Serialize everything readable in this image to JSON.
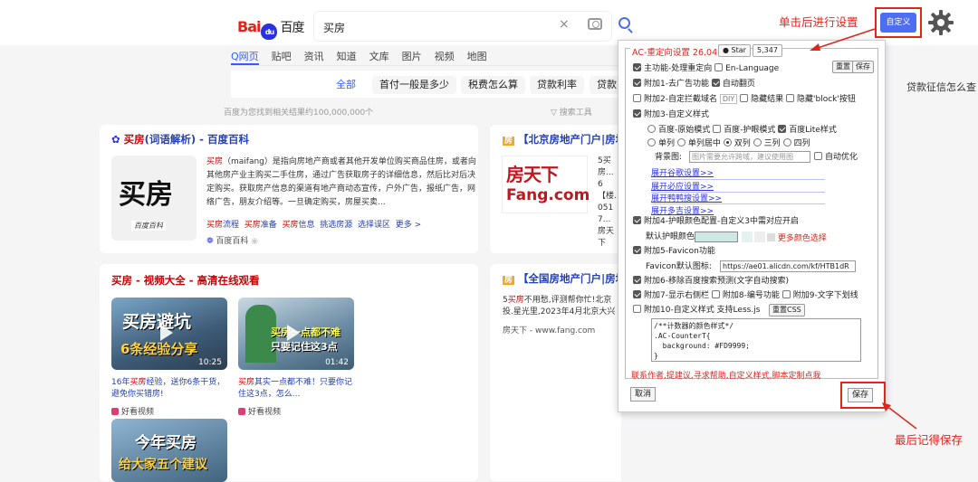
{
  "header": {
    "logo_bai": "Bai",
    "logo_du": "du",
    "logo_cn": "百度",
    "query": "买房",
    "clear_glyph": "×"
  },
  "tabs": [
    {
      "label": "Q网页",
      "active": true
    },
    {
      "label": "贴吧"
    },
    {
      "label": "资讯"
    },
    {
      "label": "知道"
    },
    {
      "label": "文库"
    },
    {
      "label": "图片"
    },
    {
      "label": "视频"
    },
    {
      "label": "地图"
    }
  ],
  "related_chips": [
    "全部",
    "首付一般是多少",
    "税费怎么算",
    "贷款利率",
    "贷款"
  ],
  "right_chip": "贷款征信怎么查",
  "result_count": "百度为您找到相关结果约100,000,000个",
  "search_tools": "搜索工具",
  "baike": {
    "title_kw": "买房",
    "title_rest": "(词语解析) - 百度百科",
    "img_big": "买房",
    "img_small": "百度百科",
    "text_kw": "买房",
    "text": "（maifang）是指向房地产商或者其他开发单位购买商品住房，或者向其他房产业主购买二手住房，通过广告获取房子的详细信息，然后比对后决定购买。获取房产信息的渠道有地产商动态宣传，户外广告，报纸广告，网络广告，朋友介绍等。一旦确定购买，房屋买卖...",
    "links": [
      {
        "kw": "买房",
        "rest": "流程"
      },
      {
        "kw": "买房",
        "rest": "准备"
      },
      {
        "kw": "买房",
        "rest": "信息"
      },
      {
        "kw": "",
        "rest": "挑选房源"
      },
      {
        "kw": "",
        "rest": "选择误区"
      },
      {
        "kw": "",
        "rest": "更多 >"
      }
    ],
    "source": "百度百科"
  },
  "fang1": {
    "title": "【北京房地产门户|房地",
    "logo_cn": "房天下",
    "logo_en": "Fang.com",
    "lines": [
      "5买房...",
      "6【楼...",
      "051 7...",
      "房天下"
    ]
  },
  "video_card": {
    "title": "买房 - 视频大全 - 高清在线观看",
    "videos": [
      {
        "overlay1": "买房避坑",
        "overlay2": "6条经验分享",
        "duration": "10:25",
        "cap_pre": "16年",
        "cap_kw": "买房",
        "cap_post": "经验，送你6条干货，避免你买错房!",
        "source": "好看视频"
      },
      {
        "overlay1": "买房一点都不难",
        "overlay2": "只要记住这3点",
        "duration": "01:42",
        "cap_pre": "",
        "cap_kw": "买房",
        "cap_post": "其实一点都不难！只要你记住这3点，怎么...",
        "source": "好看视频"
      },
      {
        "overlay1": "今年买房",
        "overlay2": "给大家五个建议"
      }
    ]
  },
  "fang2": {
    "title": "【全国房地产门户|房地",
    "line1_pre": "5",
    "line1_kw": "买房",
    "line1_post": "不用愁,评测帮你忙!北京",
    "line2": "投.星光里,2023年4月北京大兴",
    "source": "房天下 - www.fang.com"
  },
  "panel": {
    "title": "AC-重定向设置 26.04",
    "star_label": "Star",
    "star_count": "5,347",
    "reset_label": "重置",
    "save_label_top": "保存",
    "rows": {
      "main": "主功能-处理重定向",
      "en": "En-Language",
      "ad": "附加1-去广告功能",
      "autopage": "自动翻页",
      "block": "附加2-自定拦截域名",
      "diy": "DIY",
      "hide_result": "隐藏结果",
      "hide_block": "隐藏'block'按钮",
      "style": "附加3-自定义样式",
      "m_orig": "百度-原始模式",
      "m_eye": "百度-护眼模式",
      "m_lite": "百度Lite样式",
      "c1": "单列",
      "c1c": "单列居中",
      "c2": "双列",
      "c3": "三列",
      "c4": "四列",
      "bg_label": "背景图:",
      "bg_placeholder": "图片需要允许跨域，建议使用图",
      "auto_opt": "自动优化",
      "color": "附加4-护眼颜色配置-自定义3中需对应开启",
      "default_color": "默认护眼颜色:",
      "more_color": "更多颜色选择",
      "favicon": "附加5-Favicon功能",
      "fav_default": "Favicon默认图标:",
      "fav_url": "https://ae01.alicdn.com/kf/HTB1dR",
      "predict": "附加6-移除百度搜索预测(文字自动搜索)",
      "right_bar": "附加7-显示右侧栏",
      "number": "附加8-编号功能",
      "underline": "附加9-文字下划线",
      "less": "附加10-自定义样式 支持Less.js",
      "reset_css": "重置CSS"
    },
    "links": [
      "展开谷歌设置>>",
      "展开必应设置>>",
      "展开鸭鸭搜设置>>",
      "展开多吉设置>>"
    ],
    "css_text": "/**计数器的颜色样式*/\n.AC-CounterT{\n  background: #FD9999;\n}\n/**",
    "contact": "联系作者,提建议,寻求帮助,自定义样式,脚本定制点我",
    "cancel": "取消",
    "save": "保存"
  },
  "custom_btn": "自定义",
  "annotations": {
    "top": "单击后进行设置",
    "bottom": "最后记得保存"
  },
  "colors": {
    "accent": "#4e6ef2",
    "red": "#e1251b",
    "link": "#2440b3",
    "eye": "#cfe8e3"
  }
}
